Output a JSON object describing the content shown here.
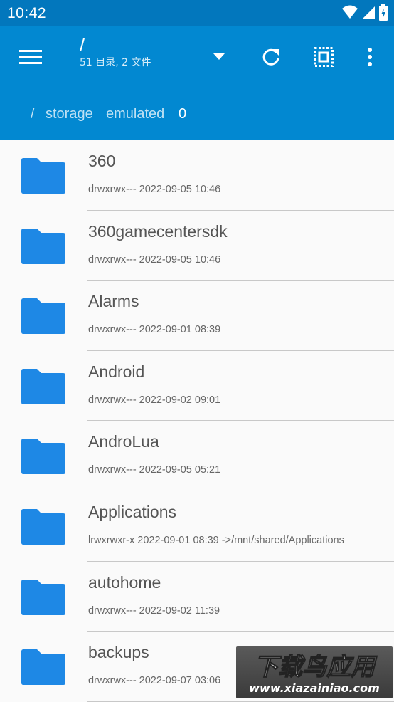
{
  "status_bar": {
    "time": "10:42",
    "icons": [
      "wifi-icon",
      "signal-icon",
      "battery-icon"
    ]
  },
  "toolbar": {
    "title": "/",
    "subtitle": "51 目录, 2 文件",
    "icons": [
      "menu-icon",
      "dropdown-icon",
      "refresh-icon",
      "select-all-icon",
      "more-vert-icon"
    ]
  },
  "breadcrumb": {
    "items": [
      "/",
      "storage",
      "emulated",
      "0"
    ]
  },
  "files": [
    {
      "name": "360",
      "meta": "drwxrwx--- 2022-09-05 10:46"
    },
    {
      "name": "360gamecentersdk",
      "meta": "drwxrwx--- 2022-09-05 10:46"
    },
    {
      "name": "Alarms",
      "meta": "drwxrwx--- 2022-09-01 08:39"
    },
    {
      "name": "Android",
      "meta": "drwxrwx--- 2022-09-02 09:01"
    },
    {
      "name": "AndroLua",
      "meta": "drwxrwx--- 2022-09-05 05:21"
    },
    {
      "name": "Applications",
      "meta": "lrwxrwxr-x 2022-09-01 08:39  ->/mnt/shared/Applications"
    },
    {
      "name": "autohome",
      "meta": "drwxrwx--- 2022-09-02 11:39"
    },
    {
      "name": "backups",
      "meta": "drwxrwx--- 2022-09-07 03:06"
    }
  ],
  "watermark": {
    "title": "下载鸟应用",
    "url": "www.xiazainiao.com"
  },
  "colors": {
    "status_bar": "#0277bd",
    "toolbar": "#0288d1",
    "folder_icon": "#1e88e5",
    "background": "#fafafa"
  }
}
